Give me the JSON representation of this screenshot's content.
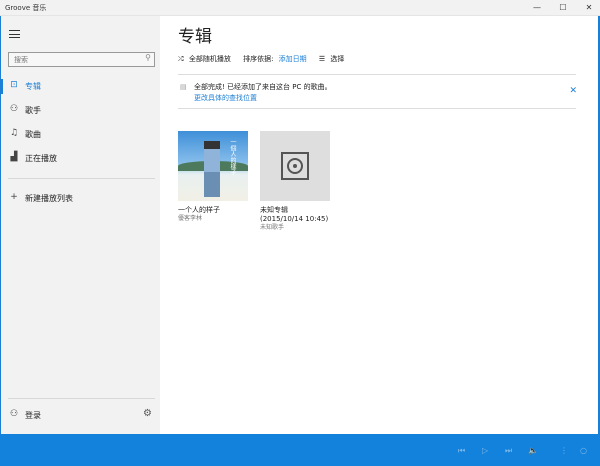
{
  "window": {
    "title": "Groove 音乐",
    "minimize": "—",
    "maximize": "☐",
    "close": "✕"
  },
  "sidebar": {
    "search_placeholder": "搜索",
    "items": [
      {
        "label": "专辑",
        "icon": "album-icon"
      },
      {
        "label": "歌手",
        "icon": "person-icon"
      },
      {
        "label": "歌曲",
        "icon": "music-note-icon"
      },
      {
        "label": "正在播放",
        "icon": "now-playing-icon"
      }
    ],
    "new_playlist": "新建播放列表",
    "login": "登录"
  },
  "main": {
    "title": "专辑",
    "shuffle_all": "全部随机播放",
    "sort_label": "排序依据:",
    "sort_value": "添加日期",
    "select": "选择",
    "notice": {
      "message": "全部完成! 已经添加了来自这台 PC 的歌曲。",
      "link": "更改具体的查找位置"
    },
    "albums": [
      {
        "title": "一个人的样子",
        "artist": "優客李林",
        "cover_text": "一個人的樣子"
      },
      {
        "title": "未知专辑",
        "subtitle": "(2015/10/14 10:45)",
        "artist": "未知歌手"
      }
    ]
  },
  "colors": {
    "accent": "#1b7fd6",
    "player_bar": "#1382dc"
  }
}
